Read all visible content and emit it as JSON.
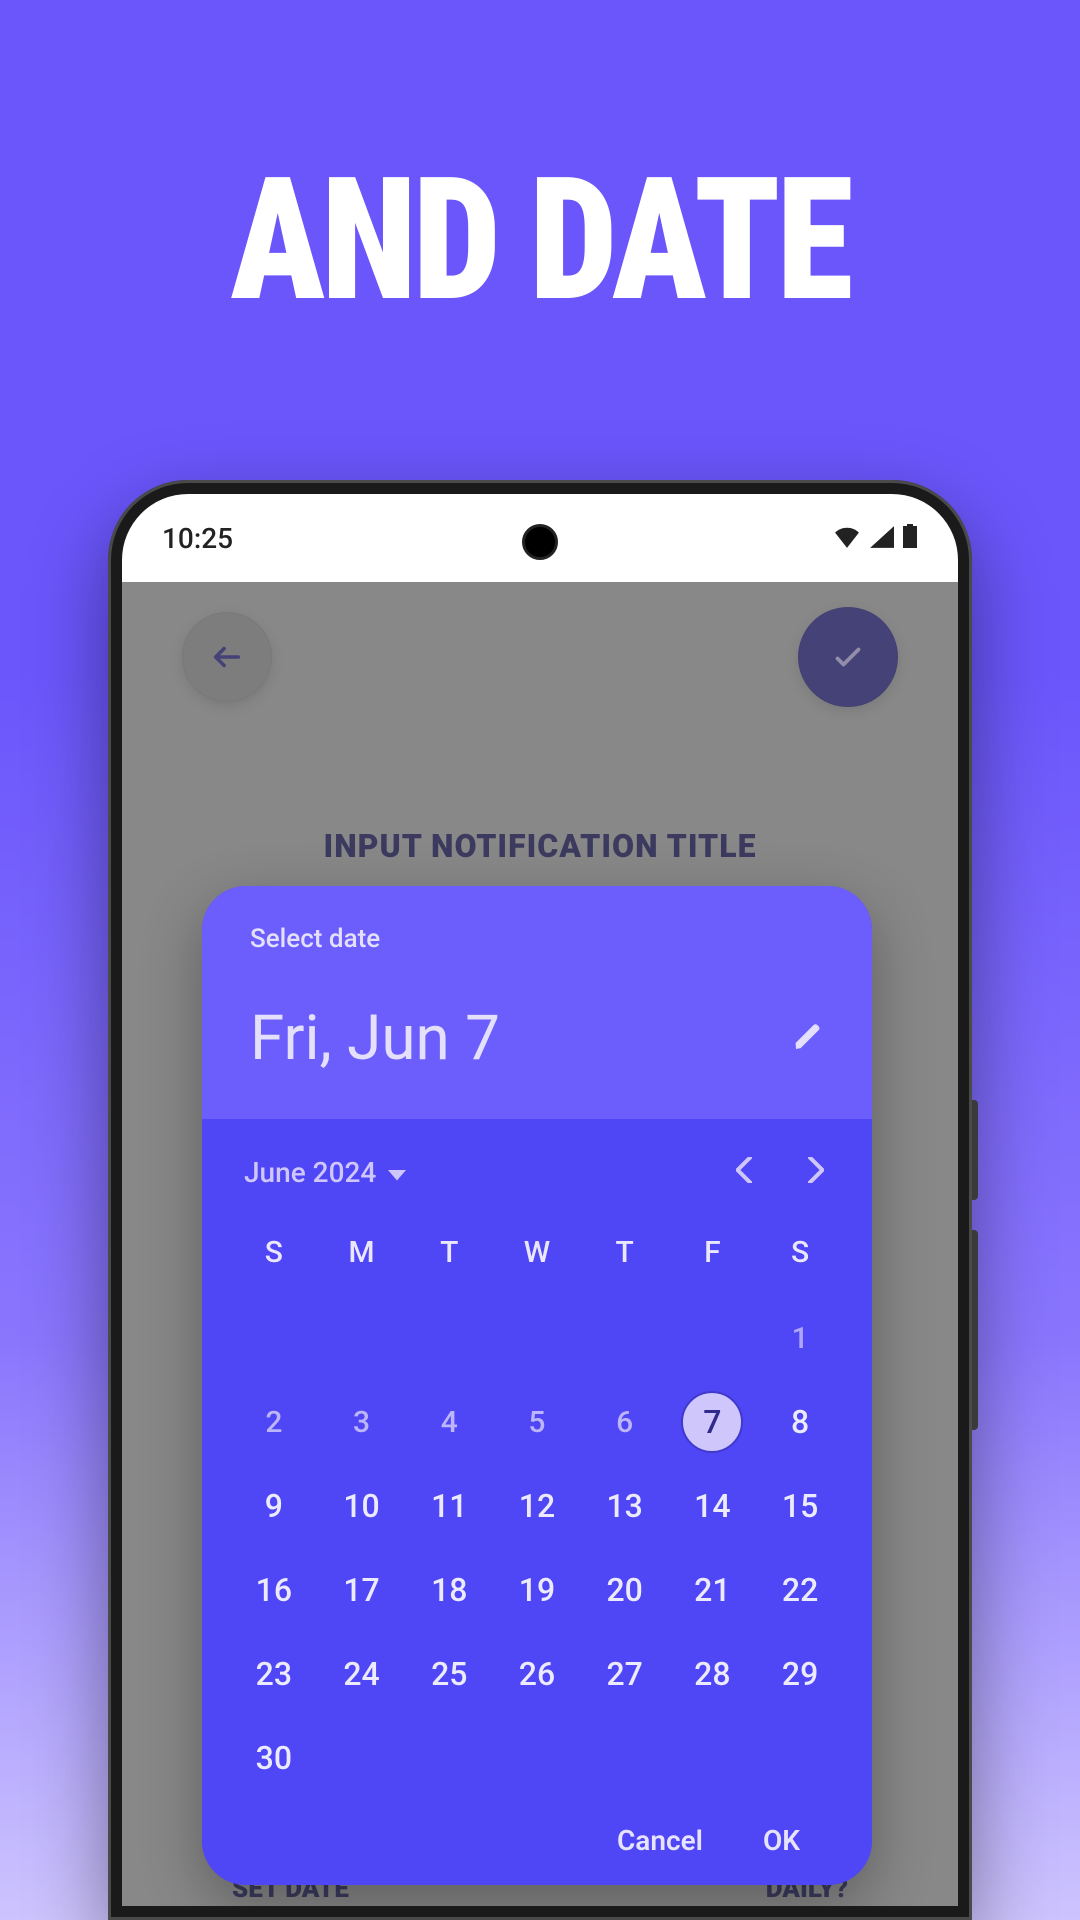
{
  "hero": {
    "title": "AND DATE"
  },
  "statusbar": {
    "time": "10:25"
  },
  "topbar": {
    "card_title": "INPUT NOTIFICATION TITLE"
  },
  "bottom": {
    "set_date": "SET DATE",
    "daily": "DAILY?"
  },
  "datepicker": {
    "select_label": "Select date",
    "date_display": "Fri, Jun 7",
    "month_label": "June 2024",
    "weekdays": [
      "S",
      "M",
      "T",
      "W",
      "T",
      "F",
      "S"
    ],
    "weeks": [
      [
        "",
        "",
        "",
        "",
        "",
        "",
        "1"
      ],
      [
        "2",
        "3",
        "4",
        "5",
        "6",
        "7",
        "8"
      ],
      [
        "9",
        "10",
        "11",
        "12",
        "13",
        "14",
        "15"
      ],
      [
        "16",
        "17",
        "18",
        "19",
        "20",
        "21",
        "22"
      ],
      [
        "23",
        "24",
        "25",
        "26",
        "27",
        "28",
        "29"
      ],
      [
        "30",
        "",
        "",
        "",
        "",
        "",
        ""
      ]
    ],
    "selected": "7",
    "actions": {
      "cancel": "Cancel",
      "ok": "OK"
    }
  }
}
